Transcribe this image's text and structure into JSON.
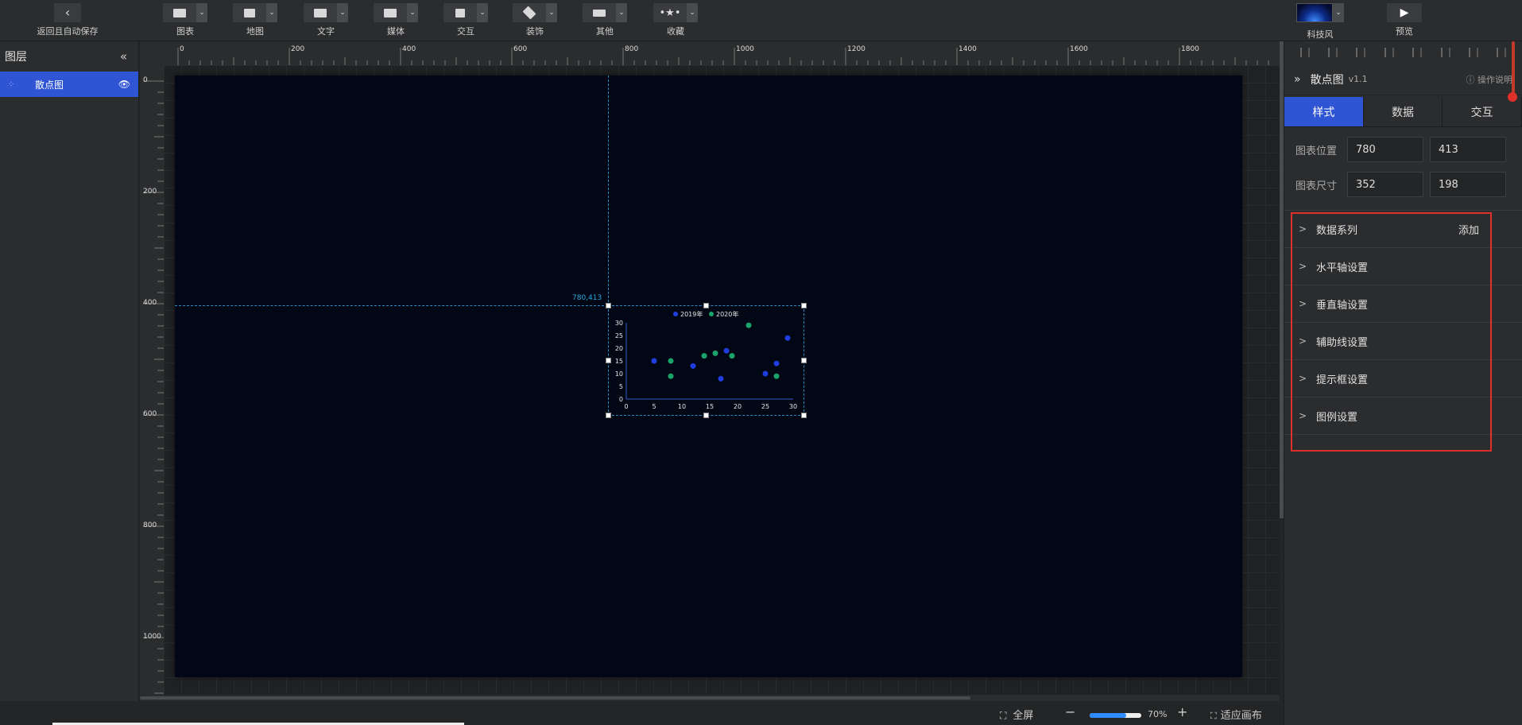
{
  "topbar": {
    "back_icon": "chevron-left-icon",
    "back_label": "返回且自动保存",
    "buttons": [
      {
        "label": "图表",
        "icon": "chart-icon"
      },
      {
        "label": "地图",
        "icon": "map-icon"
      },
      {
        "label": "文字",
        "icon": "text-icon"
      },
      {
        "label": "媒体",
        "icon": "media-icon"
      },
      {
        "label": "交互",
        "icon": "interaction-icon"
      },
      {
        "label": "装饰",
        "icon": "decoration-icon"
      },
      {
        "label": "其他",
        "icon": "other-icon"
      },
      {
        "label": "收藏",
        "icon": "star-icon"
      }
    ],
    "theme_label": "科技风",
    "preview_label": "预览",
    "preview_icon": "play-icon"
  },
  "layers": {
    "title": "图层",
    "collapse_icon": "double-chevron-left-icon",
    "items": [
      {
        "name": "散点图",
        "visible": true
      }
    ]
  },
  "rulers": {
    "h_labels": [
      "0",
      "200",
      "400",
      "600",
      "800",
      "1000",
      "1200",
      "1400",
      "1600",
      "1800"
    ],
    "v_labels": [
      "0",
      "200",
      "400",
      "600",
      "800",
      "1000"
    ]
  },
  "canvas": {
    "background": "#020716",
    "coord_label": "780,413"
  },
  "chart_data": {
    "type": "scatter",
    "legend": [
      "2019年",
      "2020年"
    ],
    "series": [
      {
        "name": "2019年",
        "color": "#1f3ee0",
        "points": [
          [
            5,
            15
          ],
          [
            12,
            13
          ],
          [
            17,
            8
          ],
          [
            18,
            19
          ],
          [
            25,
            10
          ],
          [
            27,
            14
          ],
          [
            29,
            24
          ]
        ]
      },
      {
        "name": "2020年",
        "color": "#1aa36a",
        "points": [
          [
            8,
            15
          ],
          [
            8,
            9
          ],
          [
            14,
            17
          ],
          [
            16,
            18
          ],
          [
            19,
            17
          ],
          [
            22,
            29
          ],
          [
            27,
            9
          ]
        ]
      }
    ],
    "xticks": [
      "0",
      "5",
      "10",
      "15",
      "20",
      "25",
      "30"
    ],
    "yticks": [
      "0",
      "5",
      "10",
      "15",
      "20",
      "25",
      "30"
    ],
    "xlim": [
      0,
      30
    ],
    "ylim": [
      0,
      30
    ]
  },
  "bottom": {
    "fullscreen_label": "全屏",
    "zoom_value": "70%",
    "zoom_fraction": 0.7,
    "fit_label": "适应画布"
  },
  "panel": {
    "expand_icon": "double-chevron-right-icon",
    "name": "散点图",
    "version": "v1.1",
    "help_label": "操作说明",
    "tabs": [
      "样式",
      "数据",
      "交互"
    ],
    "active_tab": "样式",
    "position_label": "图表位置",
    "position_x": "780",
    "position_y": "413",
    "size_label": "图表尺寸",
    "size_w": "352",
    "size_h": "198",
    "sections": [
      {
        "label": "数据系列",
        "action": "添加"
      },
      {
        "label": "水平轴设置"
      },
      {
        "label": "垂直轴设置"
      },
      {
        "label": "辅助线设置"
      },
      {
        "label": "提示框设置"
      },
      {
        "label": "图例设置"
      }
    ]
  }
}
